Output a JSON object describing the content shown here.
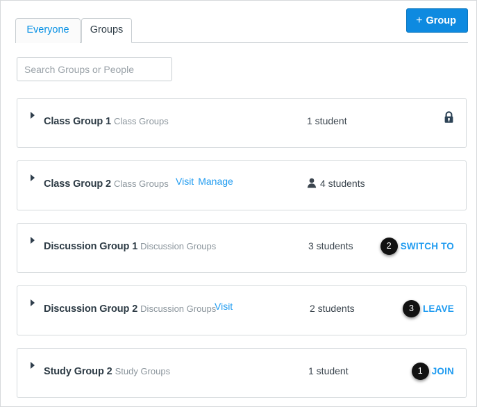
{
  "header": {
    "tabs": [
      {
        "label": "Everyone",
        "active": false
      },
      {
        "label": "Groups",
        "active": true
      }
    ],
    "add_group_button": {
      "plus": "+",
      "label": "Group"
    }
  },
  "search": {
    "placeholder": "Search Groups or People",
    "value": ""
  },
  "groups": [
    {
      "name": "Class Group 1",
      "category": "Class Groups",
      "links": [],
      "student_count": "1 student",
      "has_person_icon": false,
      "right": {
        "type": "lock-icon"
      }
    },
    {
      "name": "Class Group 2",
      "category": "Class Groups",
      "links": [
        "Visit",
        "Manage"
      ],
      "student_count": "4 students",
      "has_person_icon": true,
      "right": {
        "type": "none"
      }
    },
    {
      "name": "Discussion Group 1",
      "category": "Discussion Groups",
      "links": [],
      "student_count": "3 students",
      "has_person_icon": false,
      "right": {
        "type": "action",
        "badge": "2",
        "label": "SWITCH TO"
      }
    },
    {
      "name": "Discussion Group 2",
      "category": "Discussion Groups",
      "links": [
        "Visit"
      ],
      "student_count": "2 students",
      "has_person_icon": false,
      "right": {
        "type": "action",
        "badge": "3",
        "label": "LEAVE"
      }
    },
    {
      "name": "Study Group 2",
      "category": "Study Groups",
      "links": [],
      "student_count": "1 student",
      "has_person_icon": false,
      "right": {
        "type": "action",
        "badge": "1",
        "label": "JOIN"
      }
    }
  ],
  "colors": {
    "link": "#1f9bf0",
    "button": "#0e8ae0",
    "badge": "#121212",
    "text": "#2d3b45",
    "muted": "#8b959c"
  }
}
